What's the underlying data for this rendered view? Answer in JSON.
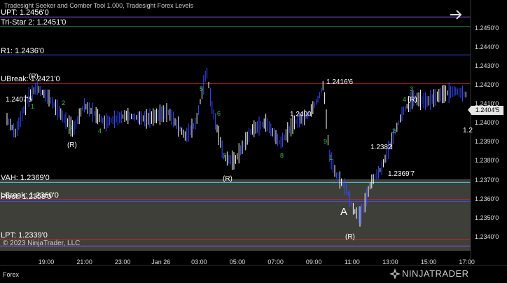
{
  "indicator_title": "Tradesight Seeker and Comber Tool 1.000, Tradesight Forex Levels",
  "levels": [
    {
      "key": "upt",
      "label": "UPT: 1.2456'0",
      "price": 1.2456,
      "color": "#8a4bd6"
    },
    {
      "key": "tristar",
      "label": "Tri-Star 2: 1.2451'0",
      "price": 1.2451,
      "color": "#2e8b57"
    },
    {
      "key": "r1",
      "label": "R1: 1.2436'0",
      "price": 1.2436,
      "color": "#3a4bff"
    },
    {
      "key": "ubreak",
      "label": "UBreak: 1.2421'0",
      "price": 1.2421,
      "color": "#c0282d"
    },
    {
      "key": "vah",
      "label": "VAH: 1.2369'0",
      "price": 1.2369,
      "color": "#3fd1d6"
    },
    {
      "key": "lbreak",
      "label": "LBreak: 1.2360'0",
      "price": 1.236,
      "color": "#c0282d"
    },
    {
      "key": "pivot",
      "label": "Pivot: 1.2359'0",
      "price": 1.2359,
      "color": "#3a4bff"
    },
    {
      "key": "lpt",
      "label": "LPT: 1.2339'0",
      "price": 1.2339,
      "color": "#c0282d"
    },
    {
      "key": "bottom",
      "label": "",
      "price": 1.23355,
      "color": "#8a4bd6"
    }
  ],
  "annotations": [
    {
      "text": "1.2407'5",
      "color": "#d020d0"
    },
    {
      "text": "1.2416'6",
      "color": "#39c24a"
    },
    {
      "text": "1.2400",
      "color": "#39c24a"
    },
    {
      "text": "1.2382",
      "color": "#39c24a"
    },
    {
      "text": "1.2369'7",
      "color": "#e0202a"
    },
    {
      "text": "1.2",
      "color": "#e0202a"
    },
    {
      "text": "(R)",
      "color": "#d020d0"
    },
    {
      "text": "(R)",
      "color": "#d020d0"
    },
    {
      "text": "(R)",
      "color": "#d020d0"
    },
    {
      "text": "(R)",
      "color": "#d020d0"
    },
    {
      "text": "(R)",
      "color": "#d020d0"
    },
    {
      "text": "A",
      "color": "#d8e040"
    }
  ],
  "current_price": "1.2404'5",
  "y_axis": {
    "ticks": [
      "1.2450'0",
      "1.2440'0",
      "1.2430'0",
      "1.2420'0",
      "1.2410'0",
      "1.2400'0",
      "1.2390'0",
      "1.2380'0",
      "1.2370'0",
      "1.2360'0",
      "1.2350'0",
      "1.2340'0"
    ],
    "min": 1.2333,
    "max": 1.2462
  },
  "x_axis": {
    "ticks": [
      "19:00",
      "21:00",
      "23:00",
      "Jan 26",
      "03:00",
      "05:00",
      "07:00",
      "09:00",
      "11:00",
      "13:00",
      "15:00",
      "17:00"
    ]
  },
  "copyright": "© 2023 NinjaTrader, LLC",
  "instrument": "Forex",
  "brand": "NINJATRADER",
  "colors": {
    "background": "#000000",
    "candle_up": "#ffffff",
    "candle_down": "#3a4bff",
    "value_area": "#4a4a44"
  }
}
